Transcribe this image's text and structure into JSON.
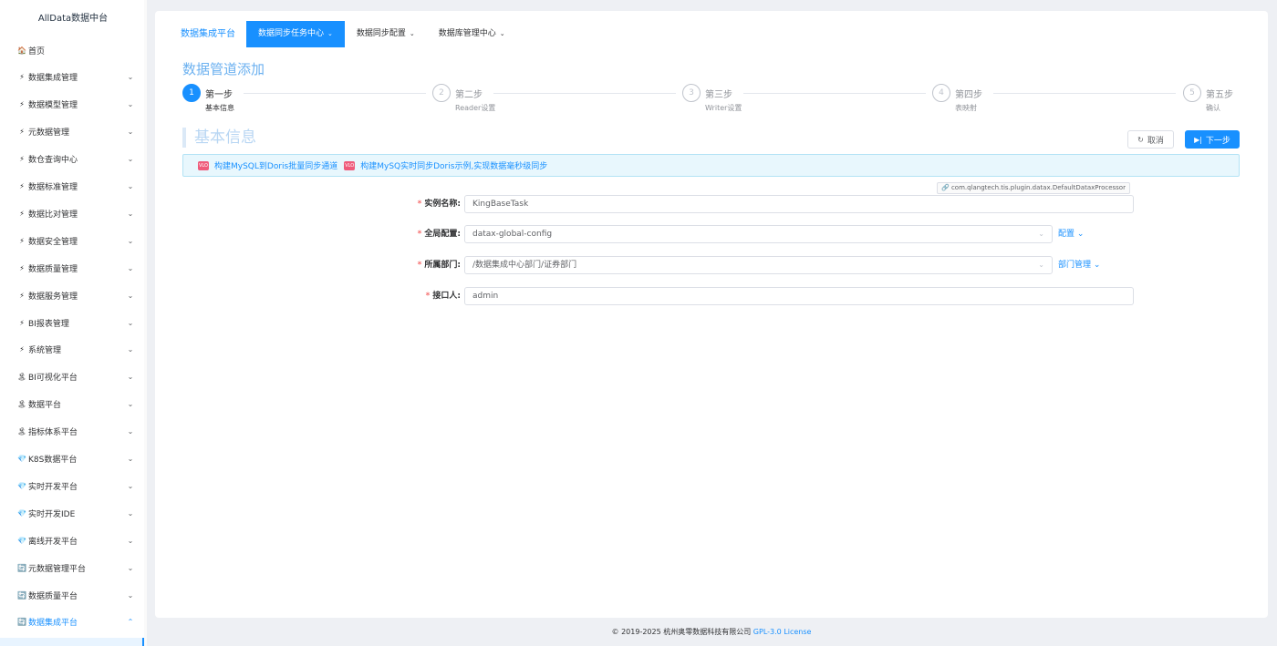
{
  "app_title": "AllData数据中台",
  "sidebar": {
    "items": [
      {
        "icon": "🏠",
        "label": "首页",
        "arrow": ""
      },
      {
        "icon": "⚡",
        "label": "数据集成管理",
        "arrow": "⌄"
      },
      {
        "icon": "⚡",
        "label": "数据模型管理",
        "arrow": "⌄"
      },
      {
        "icon": "⚡",
        "label": "元数据管理",
        "arrow": "⌄"
      },
      {
        "icon": "⚡",
        "label": "数仓查询中心",
        "arrow": "⌄"
      },
      {
        "icon": "⚡",
        "label": "数据标准管理",
        "arrow": "⌄"
      },
      {
        "icon": "⚡",
        "label": "数据比对管理",
        "arrow": "⌄"
      },
      {
        "icon": "⚡",
        "label": "数据安全管理",
        "arrow": "⌄"
      },
      {
        "icon": "⚡",
        "label": "数据质量管理",
        "arrow": "⌄"
      },
      {
        "icon": "⚡",
        "label": "数据服务管理",
        "arrow": "⌄"
      },
      {
        "icon": "⚡",
        "label": "BI报表管理",
        "arrow": "⌄"
      },
      {
        "icon": "⚡",
        "label": "系统管理",
        "arrow": "⌄"
      },
      {
        "icon": "🏝",
        "label": "BI可视化平台",
        "arrow": "⌄"
      },
      {
        "icon": "🏝",
        "label": "数据平台",
        "arrow": "⌄"
      },
      {
        "icon": "🏝",
        "label": "指标体系平台",
        "arrow": "⌄"
      },
      {
        "icon": "💎",
        "label": "K8S数据平台",
        "arrow": "⌄"
      },
      {
        "icon": "💎",
        "label": "实时开发平台",
        "arrow": "⌄"
      },
      {
        "icon": "💎",
        "label": "实时开发IDE",
        "arrow": "⌄"
      },
      {
        "icon": "💎",
        "label": "离线开发平台",
        "arrow": "⌄"
      },
      {
        "icon": "🔄",
        "label": "元数据管理平台",
        "arrow": "⌄"
      },
      {
        "icon": "🔄",
        "label": "数据质量平台",
        "arrow": "⌄"
      },
      {
        "icon": "🔄",
        "label": "数据集成平台",
        "arrow": "⌃"
      }
    ]
  },
  "topnav": {
    "items": [
      {
        "label": "数据集成平台",
        "caret": ""
      },
      {
        "label": "数据同步任务中心",
        "caret": "⌄"
      },
      {
        "label": "数据同步配置",
        "caret": "⌄"
      },
      {
        "label": "数据库管理中心",
        "caret": "⌄"
      }
    ]
  },
  "page_title": "数据管道添加",
  "steps": [
    {
      "num": "1",
      "title": "第一步",
      "desc": "基本信息",
      "status": "done"
    },
    {
      "num": "2",
      "title": "第二步",
      "desc": "Reader设置",
      "status": "wait"
    },
    {
      "num": "3",
      "title": "第三步",
      "desc": "Writer设置",
      "status": "wait"
    },
    {
      "num": "4",
      "title": "第四步",
      "desc": "表映射",
      "status": "wait"
    },
    {
      "num": "5",
      "title": "第五步",
      "desc": "确认",
      "status": "wait"
    }
  ],
  "section_title": "基本信息",
  "buttons": {
    "cancel": "取消",
    "next": "下一步"
  },
  "alert": {
    "icon_text": "VLO",
    "links": [
      "构建MySQL到Doris批量同步通道",
      "构建MySQ实时同步Doris示例,实现数据毫秒级同步"
    ]
  },
  "processor_tag": "com.qlangtech.tis.plugin.datax.DefaultDataxProcessor",
  "form": {
    "instance_name": {
      "label": "实例名称:",
      "value": "KingBaseTask"
    },
    "global_config": {
      "label": "全局配置:",
      "value": "datax-global-config",
      "link": "配置"
    },
    "department": {
      "label": "所属部门:",
      "value": "/数据集成中心部门/证券部门",
      "link": "部门管理"
    },
    "contact": {
      "label": "接口人:",
      "value": "admin"
    }
  },
  "footer": {
    "copyright": "© 2019-2025 杭州奥零数据科技有限公司",
    "license": "GPL-3.0 License"
  }
}
